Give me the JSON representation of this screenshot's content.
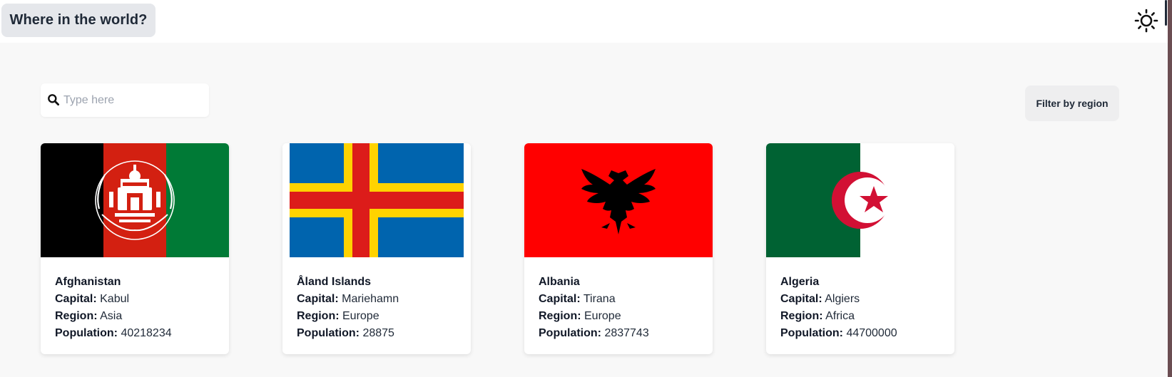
{
  "header": {
    "title": "Where in the world?",
    "theme_icon": "sun-icon"
  },
  "search": {
    "placeholder": "Type here",
    "value": "",
    "icon": "search-icon"
  },
  "filter": {
    "label": "Filter by region"
  },
  "field_labels": {
    "capital": "Capital:",
    "region": "Region:",
    "population": "Population:"
  },
  "countries": [
    {
      "name": "Afghanistan",
      "capital": "Kabul",
      "region": "Asia",
      "population": "40218234",
      "flag": "afghanistan-flag"
    },
    {
      "name": "Åland Islands",
      "capital": "Mariehamn",
      "region": "Europe",
      "population": "28875",
      "flag": "aland-islands-flag"
    },
    {
      "name": "Albania",
      "capital": "Tirana",
      "region": "Europe",
      "population": "2837743",
      "flag": "albania-flag"
    },
    {
      "name": "Algeria",
      "capital": "Algiers",
      "region": "Africa",
      "population": "44700000",
      "flag": "algeria-flag"
    }
  ],
  "colors": {
    "header_bg": "#ffffff",
    "page_bg": "#f8f8f8",
    "title_button_bg": "#e5e7eb",
    "filter_button_bg": "#eeeeef",
    "text": "#111827"
  }
}
